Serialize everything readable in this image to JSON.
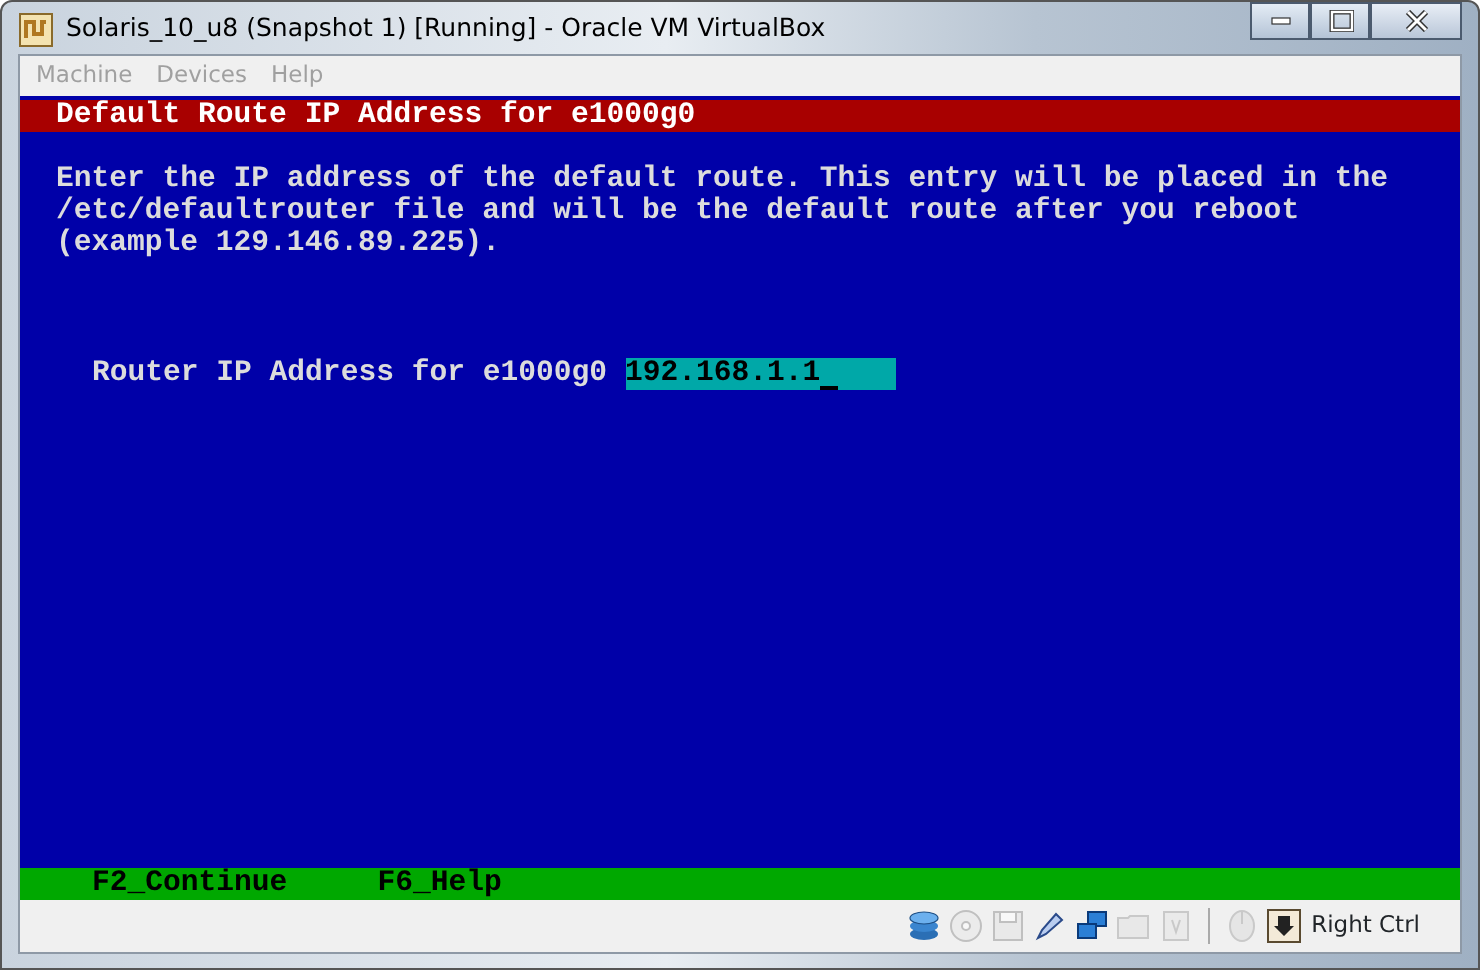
{
  "window": {
    "title": "Solaris_10_u8 (Snapshot 1) [Running] - Oracle VM VirtualBox",
    "controls": [
      {
        "kind": "minimize"
      },
      {
        "kind": "maximize"
      },
      {
        "kind": "close"
      }
    ]
  },
  "menu": [
    {
      "label": "Machine",
      "disabled": true
    },
    {
      "label": "Devices",
      "disabled": true
    },
    {
      "label": "Help",
      "disabled": true
    }
  ],
  "console": {
    "header": "Default Route IP Address for e1000g0",
    "lines": [
      "Enter the IP address of the default route. This entry will be placed in the",
      "/etc/defaultrouter file and will be the default route after you reboot",
      "(example 129.146.89.225)."
    ],
    "field": {
      "label": "Router IP Address for e1000g0",
      "value": "192.168.1.1"
    },
    "footer": [
      "F2_Continue",
      "F6_Help"
    ]
  },
  "status_bar": {
    "icons": [
      {
        "kind": "disk",
        "disabled": false
      },
      {
        "kind": "cd",
        "disabled": true
      },
      {
        "kind": "floppy",
        "disabled": true
      },
      {
        "kind": "usb",
        "disabled": false
      },
      {
        "kind": "network",
        "disabled": false
      },
      {
        "kind": "folder",
        "disabled": true
      },
      {
        "kind": "chip",
        "disabled": true
      },
      {
        "kind": "mouse",
        "disabled": true
      },
      {
        "kind": "hostkey",
        "disabled": false
      }
    ],
    "host_key": "Right Ctrl"
  }
}
